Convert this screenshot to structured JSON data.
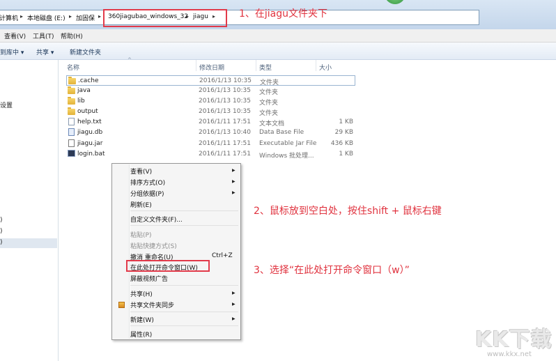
{
  "address_bar": {
    "crumbs": [
      "计算机",
      "本地磁盘 (E:)",
      "加固保",
      "360jiagubao_windows_32",
      "jiagu"
    ]
  },
  "menu_bar": [
    "查看(V)",
    "工具(T)",
    "帮助(H)"
  ],
  "toolbar": {
    "include_in_library": "到库中 ▾",
    "share": "共享 ▾",
    "new_folder": "新建文件夹"
  },
  "nav_pane": {
    "fragment_settings": "设置",
    "fragments": [
      ")",
      ")",
      ")"
    ]
  },
  "columns": {
    "name": "名称",
    "date": "修改日期",
    "type": "类型",
    "size": "大小"
  },
  "files": [
    {
      "name": ".cache",
      "date": "2016/1/13 10:35",
      "type": "文件夹",
      "size": "",
      "icon": "folder-icon"
    },
    {
      "name": "java",
      "date": "2016/1/13 10:35",
      "type": "文件夹",
      "size": "",
      "icon": "folder-icon"
    },
    {
      "name": "lib",
      "date": "2016/1/13 10:35",
      "type": "文件夹",
      "size": "",
      "icon": "folder-icon"
    },
    {
      "name": "output",
      "date": "2016/1/13 10:35",
      "type": "文件夹",
      "size": "",
      "icon": "folder-icon"
    },
    {
      "name": "help.txt",
      "date": "2016/1/11 17:51",
      "type": "文本文档",
      "size": "1 KB",
      "icon": "text-file-icon"
    },
    {
      "name": "jiagu.db",
      "date": "2016/1/13 10:40",
      "type": "Data Base File",
      "size": "29 KB",
      "icon": "database-file-icon"
    },
    {
      "name": "jiagu.jar",
      "date": "2016/1/11 17:51",
      "type": "Executable Jar File",
      "size": "436 KB",
      "icon": "jar-file-icon"
    },
    {
      "name": "login.bat",
      "date": "2016/1/11 17:51",
      "type": "Windows 批处理...",
      "size": "1 KB",
      "icon": "batch-file-icon"
    }
  ],
  "context_menu": {
    "view": "查看(V)",
    "sort_by": "排序方式(O)",
    "group_by": "分组依据(P)",
    "refresh": "刷新(E)",
    "customize_folder": "自定义文件夹(F)...",
    "paste": "粘贴(P)",
    "paste_shortcut": "粘贴快捷方式(S)",
    "undo_rename": "撤消 重命名(U)",
    "undo_shortcut": "Ctrl+Z",
    "open_cmd_here": "在此处打开命令窗口(W)",
    "block_video_ads": "屏蔽视频广告",
    "share_with": "共享(H)",
    "shared_folder_sync": "共享文件夹同步",
    "new": "新建(W)",
    "properties": "属性(R)"
  },
  "annotations": {
    "step1": "1、在jiagu文件夹下",
    "step2": "2、鼠标放到空白处，按住shift + 鼠标右键",
    "step3": "3、选择“在此处打开命令窗口（w）”"
  },
  "watermark": {
    "logo": "KK下载",
    "url": "www.kkx.net"
  },
  "colors": {
    "annotation_red": "#e0323e",
    "highlight_box": "#e23a4a"
  }
}
